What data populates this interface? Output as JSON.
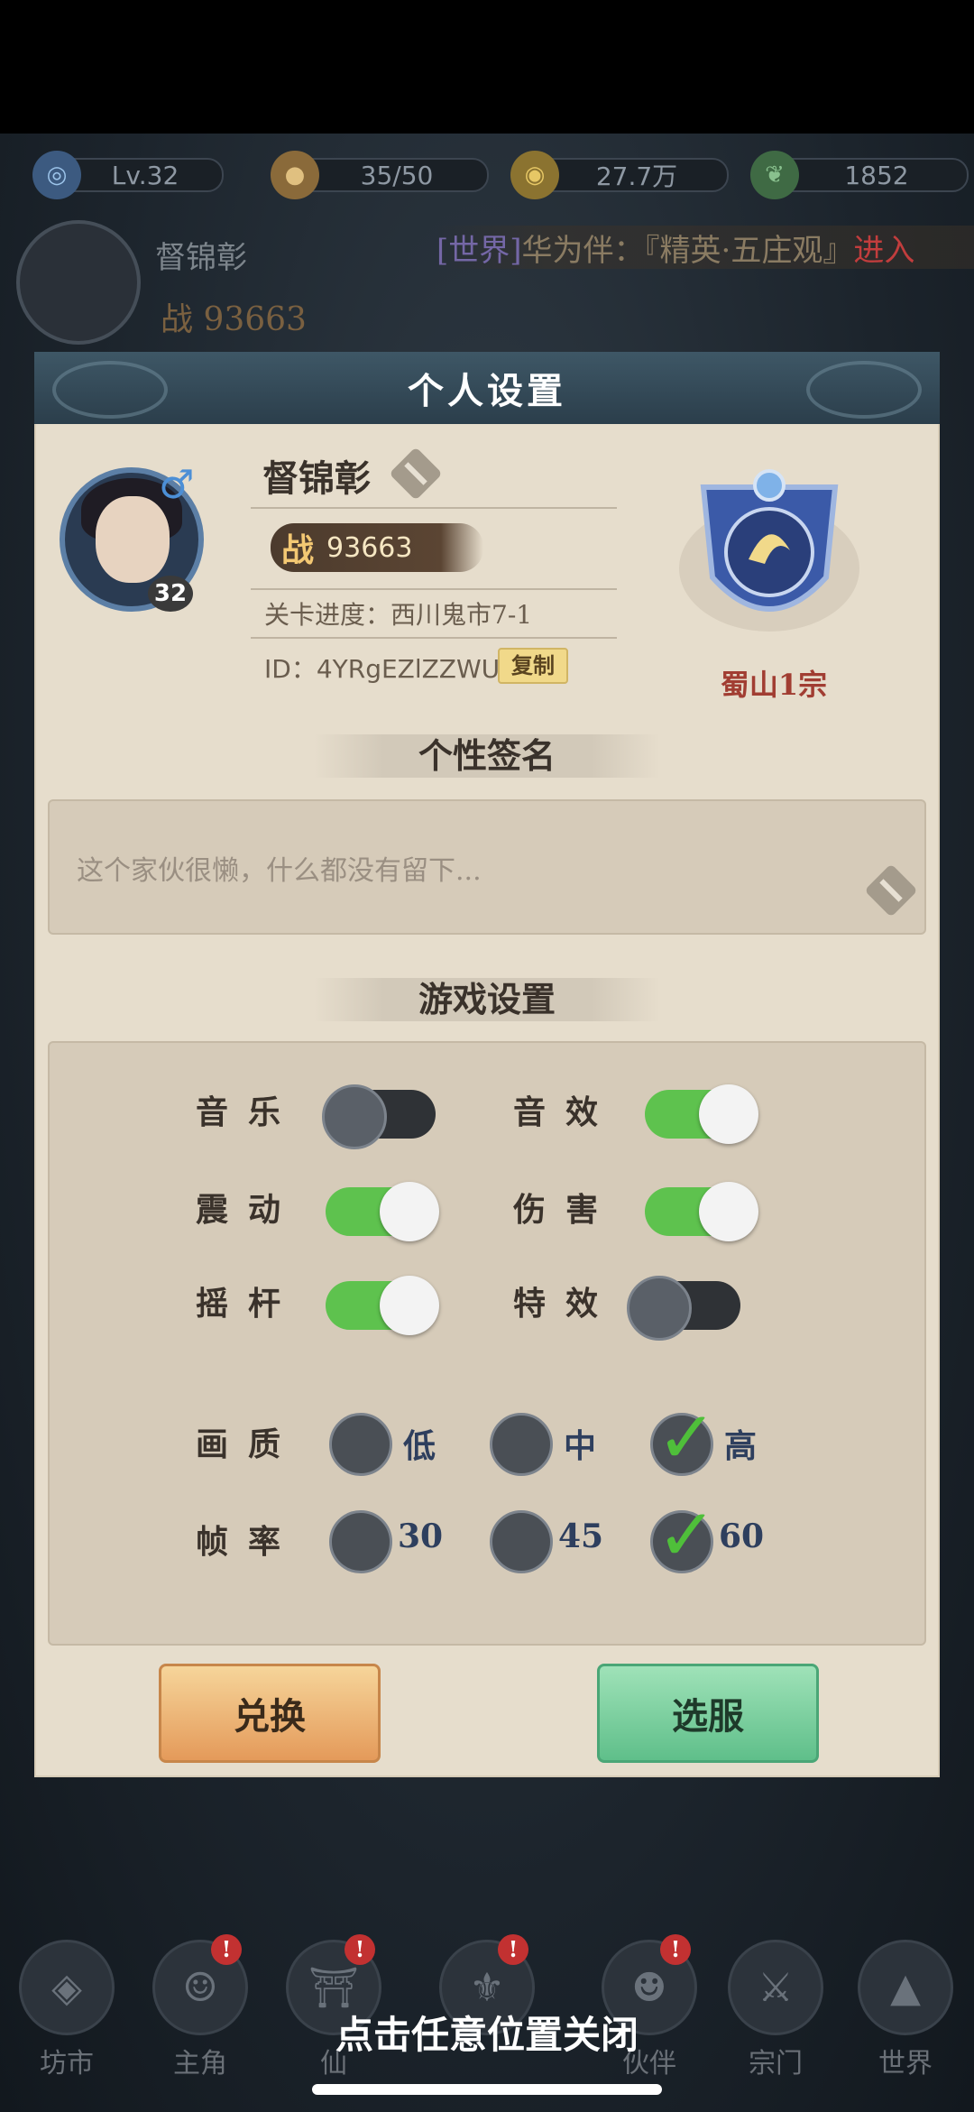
{
  "topbar": {
    "level": "Lv.32",
    "stamina": "35/50",
    "coins": "27.7万",
    "jade": "1852"
  },
  "player_bar": {
    "name": "督锦彰",
    "power": "战 93663",
    "ticker": {
      "tag": "[世界]",
      "text": "华为伴：『精英·五庄观』",
      "enter": "进入"
    }
  },
  "modal": {
    "title": "个人设置",
    "profile": {
      "level": "32",
      "gender": "♂",
      "name": "督锦彰",
      "power_prefix": "战",
      "power": "93663",
      "progress": "关卡进度：西川鬼市7-1",
      "id": "ID：4YRgEZlZZWU",
      "copy_label": "复制",
      "sect": "蜀山1宗"
    },
    "signature": {
      "title": "个性签名",
      "text": "这个家伙很懒，什么都没有留下..."
    },
    "settings": {
      "title": "游戏设置",
      "toggles": [
        {
          "label": "音乐",
          "on": false
        },
        {
          "label": "音效",
          "on": true
        },
        {
          "label": "震动",
          "on": true
        },
        {
          "label": "伤害",
          "on": true
        },
        {
          "label": "摇杆",
          "on": true
        },
        {
          "label": "特效",
          "on": false
        }
      ],
      "quality": {
        "label": "画质",
        "options": [
          "低",
          "中",
          "高"
        ],
        "selected": "高"
      },
      "framerate": {
        "label": "帧率",
        "options": [
          "30",
          "45",
          "60"
        ],
        "selected": "60"
      }
    },
    "buttons": {
      "redeem": "兑换",
      "server": "选服"
    }
  },
  "bottom_nav": {
    "items": [
      {
        "label": "坊市",
        "badge": false
      },
      {
        "label": "主角",
        "badge": true
      },
      {
        "label": "仙",
        "badge": true
      },
      {
        "label": "",
        "badge": true
      },
      {
        "label": "伙伴",
        "badge": true
      },
      {
        "label": "宗门",
        "badge": false
      },
      {
        "label": "世界",
        "badge": false
      }
    ],
    "badge_text": "!"
  },
  "close_hint": "点击任意位置关闭",
  "colors": {
    "toggle_on": "#5ec24e",
    "toggle_off": "#2f3236",
    "check": "#4fbf3a",
    "header": "#2b3e4b",
    "panel": "#e6ddcc"
  }
}
